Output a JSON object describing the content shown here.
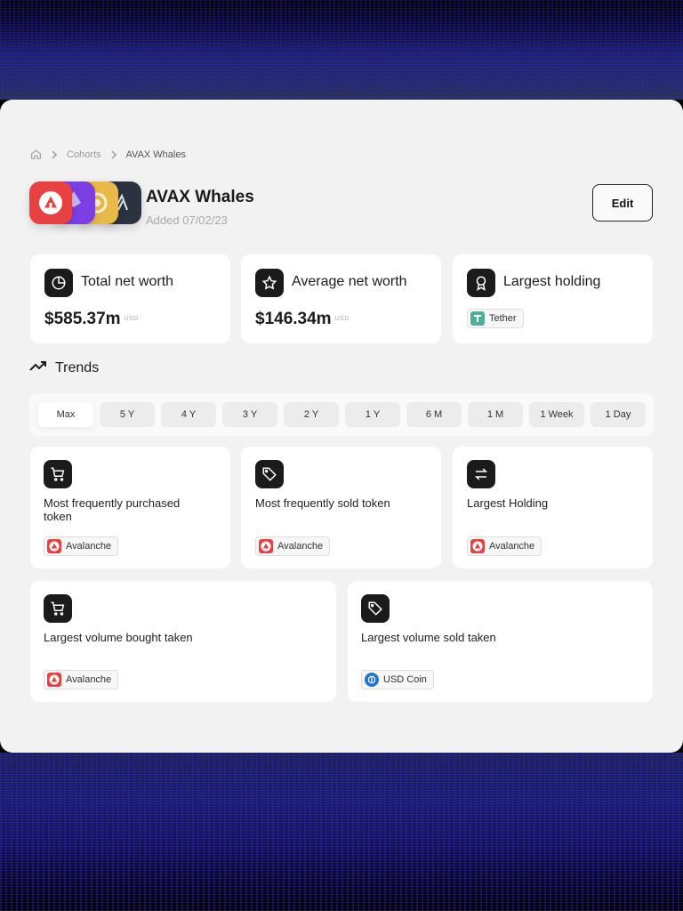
{
  "breadcrumb": {
    "items": [
      "Cohorts",
      "AVAX Whales"
    ]
  },
  "header": {
    "title": "AVAX Whales",
    "subtitle": "Added 07/02/23",
    "edit_label": "Edit",
    "logos": [
      "avalanche-logo",
      "ethereum-logo",
      "gold-token-logo",
      "arbitrum-logo"
    ]
  },
  "stats": [
    {
      "label": "Total net worth",
      "value": "$585.37m",
      "unit": "USD",
      "icon": "pie-chart-icon"
    },
    {
      "label": "Average net worth",
      "value": "$146.34m",
      "unit": "USD",
      "icon": "star-icon"
    },
    {
      "label": "Largest holding",
      "token": "Tether",
      "icon": "award-icon"
    }
  ],
  "trends": {
    "title": "Trends",
    "filters": [
      "Max",
      "5 Y",
      "4 Y",
      "3 Y",
      "2 Y",
      "1 Y",
      "6 M",
      "1 M",
      "1 Week",
      "1 Day"
    ],
    "active_filter": "Max",
    "cards": [
      {
        "label": "Most frequently purchased token",
        "token": "Avalanche",
        "icon": "cart-icon"
      },
      {
        "label": "Most frequently sold token",
        "token": "Avalanche",
        "icon": "tag-icon"
      },
      {
        "label": "Largest Holding",
        "token": "Avalanche",
        "icon": "swap-icon"
      },
      {
        "label": "Largest volume bought taken",
        "token": "Avalanche",
        "icon": "cart-icon"
      },
      {
        "label": "Largest volume sold taken",
        "token": "USD Coin",
        "icon": "tag-icon"
      }
    ]
  },
  "colors": {
    "avalanche": "#e84142",
    "tether": "#50af95",
    "usdc": "#2775ca",
    "dark": "#1b1b1b"
  }
}
